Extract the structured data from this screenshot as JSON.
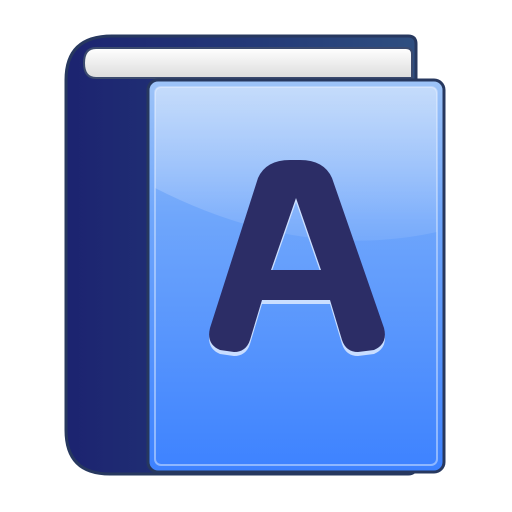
{
  "icon": {
    "name": "dictionary-book-icon",
    "cover_letter": "A",
    "colors": {
      "spine_dark": "#1f2670",
      "spine_light": "#2e4a7e",
      "outline": "#27385f",
      "cover_top": "#aacdfb",
      "cover_mid": "#6aa4ff",
      "cover_bottom": "#3a7eff",
      "pages": "#f2f2f2",
      "letter": "#2c2d66",
      "letter_highlight": "#d6e6ff"
    }
  }
}
